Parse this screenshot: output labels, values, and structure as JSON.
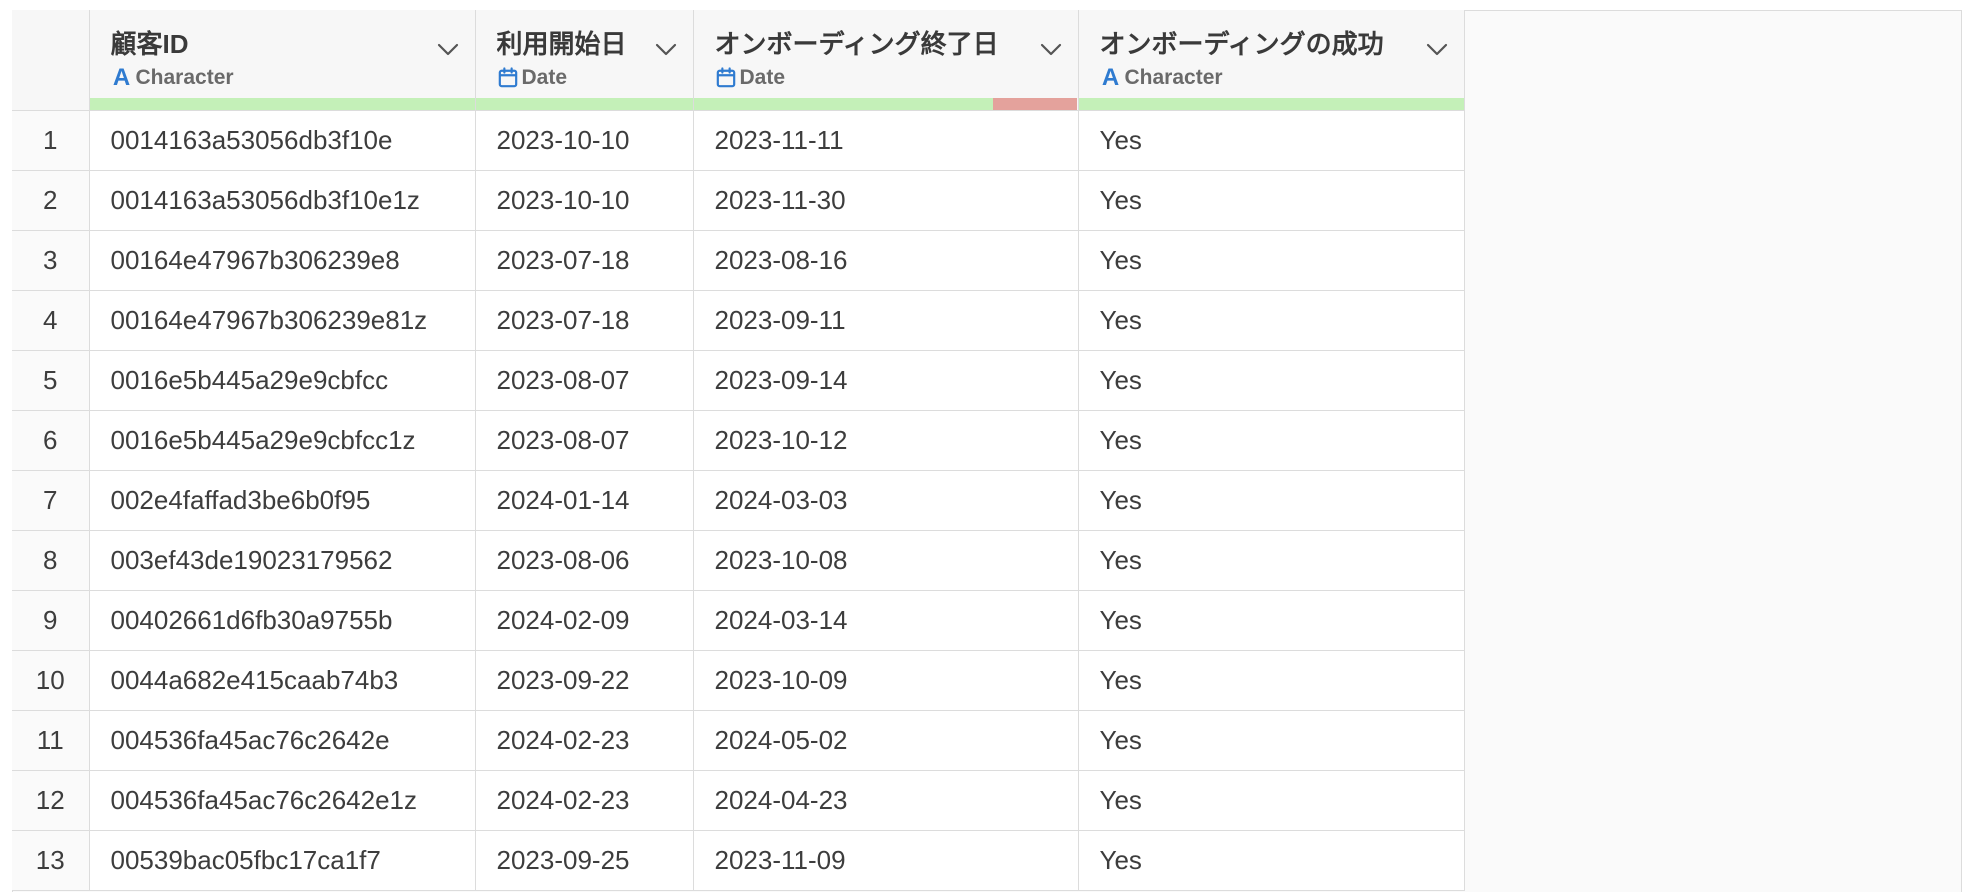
{
  "columns": [
    {
      "name": "顧客ID",
      "type": "Character",
      "icon": "character-type-icon",
      "quality": {
        "valid": 1.0,
        "invalid": 0.0
      }
    },
    {
      "name": "利用開始日",
      "type": "Date",
      "icon": "calendar-icon",
      "quality": {
        "valid": 1.0,
        "invalid": 0.0
      }
    },
    {
      "name": "オンボーディング終了日",
      "type": "Date",
      "icon": "calendar-icon",
      "quality": {
        "valid": 0.78,
        "invalid": 0.22
      }
    },
    {
      "name": "オンボーディングの成功",
      "type": "Character",
      "icon": "character-type-icon",
      "quality": {
        "valid": 1.0,
        "invalid": 0.0
      }
    }
  ],
  "type_icon_letter": "A",
  "rows": [
    {
      "index": "1",
      "cells": [
        "0014163a53056db3f10e",
        "2023-10-10",
        "2023-11-11",
        "Yes"
      ]
    },
    {
      "index": "2",
      "cells": [
        "0014163a53056db3f10e1z",
        "2023-10-10",
        "2023-11-30",
        "Yes"
      ]
    },
    {
      "index": "3",
      "cells": [
        "00164e47967b306239e8",
        "2023-07-18",
        "2023-08-16",
        "Yes"
      ]
    },
    {
      "index": "4",
      "cells": [
        "00164e47967b306239e81z",
        "2023-07-18",
        "2023-09-11",
        "Yes"
      ]
    },
    {
      "index": "5",
      "cells": [
        "0016e5b445a29e9cbfcc",
        "2023-08-07",
        "2023-09-14",
        "Yes"
      ]
    },
    {
      "index": "6",
      "cells": [
        "0016e5b445a29e9cbfcc1z",
        "2023-08-07",
        "2023-10-12",
        "Yes"
      ]
    },
    {
      "index": "7",
      "cells": [
        "002e4faffad3be6b0f95",
        "2024-01-14",
        "2024-03-03",
        "Yes"
      ]
    },
    {
      "index": "8",
      "cells": [
        "003ef43de19023179562",
        "2023-08-06",
        "2023-10-08",
        "Yes"
      ]
    },
    {
      "index": "9",
      "cells": [
        "00402661d6fb30a9755b",
        "2024-02-09",
        "2024-03-14",
        "Yes"
      ]
    },
    {
      "index": "10",
      "cells": [
        "0044a682e415caab74b3",
        "2023-09-22",
        "2023-10-09",
        "Yes"
      ]
    },
    {
      "index": "11",
      "cells": [
        "004536fa45ac76c2642e",
        "2024-02-23",
        "2024-05-02",
        "Yes"
      ]
    },
    {
      "index": "12",
      "cells": [
        "004536fa45ac76c2642e1z",
        "2024-02-23",
        "2024-04-23",
        "Yes"
      ]
    },
    {
      "index": "13",
      "cells": [
        "00539bac05fbc17ca1f7",
        "2023-09-25",
        "2023-11-09",
        "Yes"
      ]
    }
  ],
  "colors": {
    "quality_valid": "#c4f0b8",
    "quality_invalid": "#e4a29c",
    "type_icon": "#2f7bd0"
  }
}
